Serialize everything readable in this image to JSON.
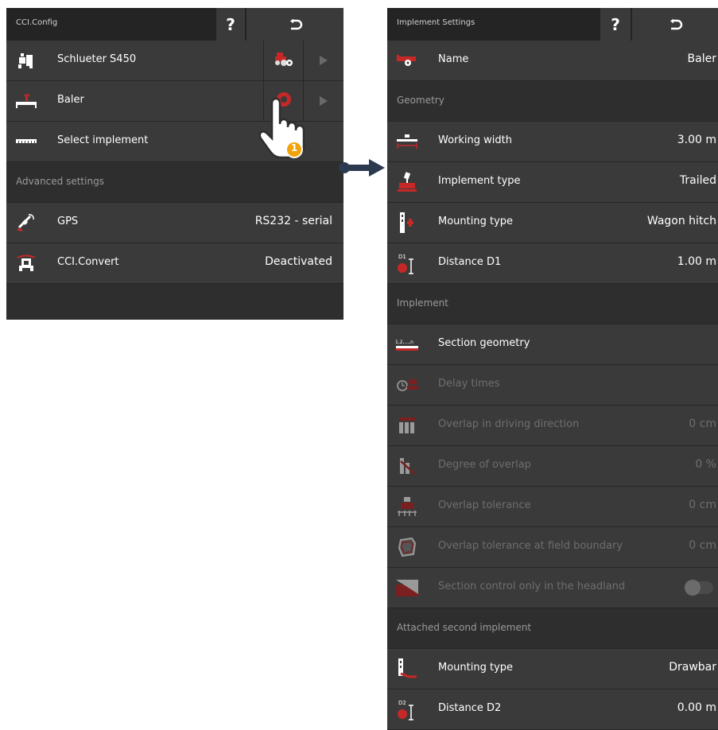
{
  "left": {
    "title": "CCI.Config",
    "help_label": "?",
    "rows": [
      {
        "label": "Schlueter S450"
      },
      {
        "label": "Baler"
      },
      {
        "label": "Select implement"
      }
    ],
    "advanced_header": "Advanced settings",
    "gps": {
      "label": "GPS",
      "value": "RS232 - serial"
    },
    "convert": {
      "label": "CCI.Convert",
      "value": "Deactivated"
    }
  },
  "callout_number": "1",
  "right": {
    "title": "Implement Settings",
    "help_label": "?",
    "name": {
      "label": "Name",
      "value": "Baler"
    },
    "geometry_header": "Geometry",
    "working_width": {
      "label": "Working width",
      "value": "3.00 m"
    },
    "implement_type": {
      "label": "Implement type",
      "value": "Trailed"
    },
    "mounting_type": {
      "label": "Mounting type",
      "value": "Wagon hitch"
    },
    "distance_d1": {
      "label": "Distance D1",
      "value": "1.00 m",
      "icon_text": "D1"
    },
    "implement_header": "Implement",
    "section_geometry": {
      "label": "Section geometry",
      "icon_text": "1,2,...,n"
    },
    "delay_times": {
      "label": "Delay times"
    },
    "overlap_driving": {
      "label": "Overlap in driving direction",
      "value": "0 cm"
    },
    "degree_overlap": {
      "label": "Degree of overlap",
      "value": "0 %"
    },
    "overlap_tolerance": {
      "label": "Overlap tolerance",
      "value": "0 cm"
    },
    "overlap_boundary": {
      "label": "Overlap tolerance at field boundary",
      "value": "0 cm"
    },
    "headland": {
      "label": "Section control only in the headland",
      "state": "off"
    },
    "second_header": "Attached second implement",
    "mounting_type2": {
      "label": "Mounting type",
      "value": "Drawbar"
    },
    "distance_d2": {
      "label": "Distance D2",
      "value": "0.00 m",
      "icon_text": "D2"
    }
  },
  "colors": {
    "panel_bg": "#2e2e2e",
    "row_bg": "#3a3a3a",
    "accent_red": "#c62828",
    "disabled_text": "#6e6e6e",
    "callout_orange": "#f0a30a",
    "arrow_blue": "#2b3a4f"
  }
}
